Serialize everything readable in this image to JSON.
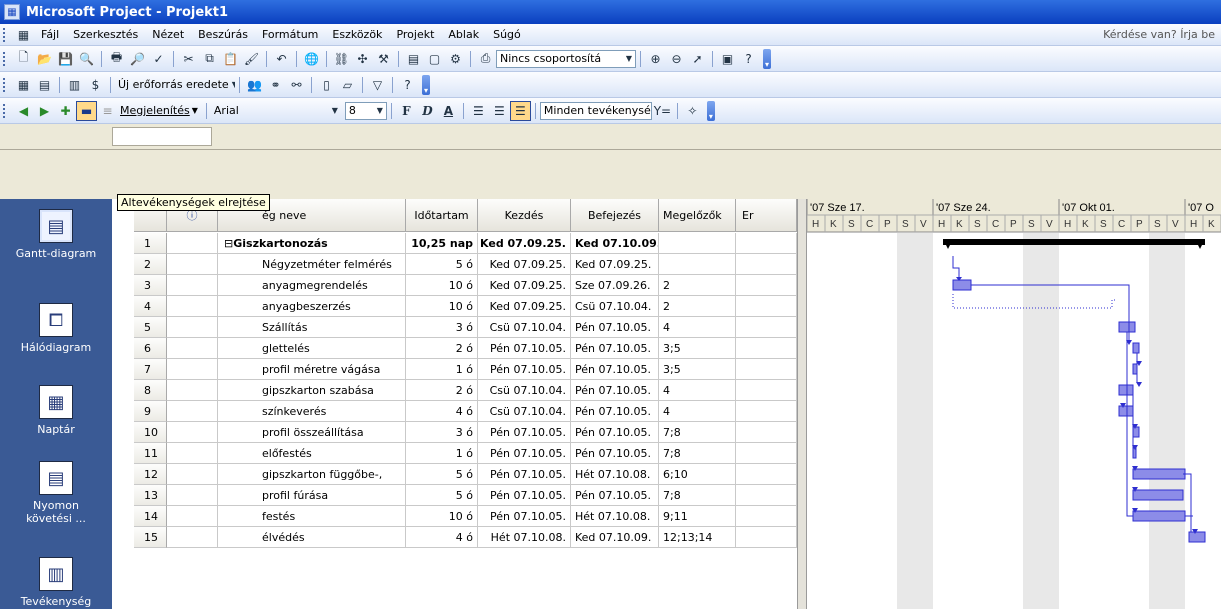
{
  "window": {
    "title": "Microsoft Project - Projekt1"
  },
  "menu": {
    "items": [
      "Fájl",
      "Szerkesztés",
      "Nézet",
      "Beszúrás",
      "Formátum",
      "Eszközök",
      "Projekt",
      "Ablak",
      "Súgó"
    ],
    "help_box": "Kérdése van? Írja be"
  },
  "toolbar1": {
    "group_combo": "Nincs csoportosítá"
  },
  "toolbar2": {
    "resource_source": "Új erőforrás eredete"
  },
  "toolbar3": {
    "display_label": "Megjelenítés",
    "font": "Arial",
    "font_size": "8",
    "bold": "F",
    "italic": "D",
    "underline": "A",
    "filter_combo": "Minden tevékenysé"
  },
  "tooltip": "Altevékenységek elrejtése",
  "viewbar": {
    "items": [
      {
        "label": "Gantt-diagram",
        "icon": "gantt-icon"
      },
      {
        "label": "Hálódiagram",
        "icon": "network-icon"
      },
      {
        "label": "Naptár",
        "icon": "calendar-icon"
      },
      {
        "label": "Nyomon követési ...",
        "icon": "tracking-gantt-icon"
      },
      {
        "label": "Tevékenység",
        "icon": "task-usage-icon"
      }
    ]
  },
  "table": {
    "headers": {
      "name": "ég neve",
      "duration": "Időtartam",
      "start": "Kezdés",
      "finish": "Befejezés",
      "predecessors": "Megelőzők",
      "resources": "Er"
    },
    "rows": [
      {
        "id": "1",
        "name": "Giszkartonozás",
        "duration": "10,25 nap",
        "start": "Ked 07.09.25.",
        "finish": "Ked 07.10.09.",
        "pred": "",
        "summary": true
      },
      {
        "id": "2",
        "name": "Négyzetméter felmérés",
        "duration": "5 ó",
        "start": "Ked 07.09.25.",
        "finish": "Ked 07.09.25.",
        "pred": ""
      },
      {
        "id": "3",
        "name": "anyagmegrendelés",
        "duration": "10 ó",
        "start": "Ked 07.09.25.",
        "finish": "Sze 07.09.26.",
        "pred": "2"
      },
      {
        "id": "4",
        "name": "anyagbeszerzés",
        "duration": "10 ó",
        "start": "Ked 07.09.25.",
        "finish": "Csü 07.10.04.",
        "pred": "2"
      },
      {
        "id": "5",
        "name": "Szállítás",
        "duration": "3 ó",
        "start": "Csü 07.10.04.",
        "finish": "Pén 07.10.05.",
        "pred": "4"
      },
      {
        "id": "6",
        "name": "glettelés",
        "duration": "2 ó",
        "start": "Pén 07.10.05.",
        "finish": "Pén 07.10.05.",
        "pred": "3;5"
      },
      {
        "id": "7",
        "name": "profil méretre vágása",
        "duration": "1 ó",
        "start": "Pén 07.10.05.",
        "finish": "Pén 07.10.05.",
        "pred": "3;5"
      },
      {
        "id": "8",
        "name": "gipszkarton szabása",
        "duration": "2 ó",
        "start": "Csü 07.10.04.",
        "finish": "Pén 07.10.05.",
        "pred": "4"
      },
      {
        "id": "9",
        "name": "színkeverés",
        "duration": "4 ó",
        "start": "Csü 07.10.04.",
        "finish": "Pén 07.10.05.",
        "pred": "4"
      },
      {
        "id": "10",
        "name": "profil összeállítása",
        "duration": "3 ó",
        "start": "Pén 07.10.05.",
        "finish": "Pén 07.10.05.",
        "pred": "7;8"
      },
      {
        "id": "11",
        "name": "előfestés",
        "duration": "1 ó",
        "start": "Pén 07.10.05.",
        "finish": "Pén 07.10.05.",
        "pred": "7;8"
      },
      {
        "id": "12",
        "name": "gipszkarton függőbe-,",
        "duration": "5 ó",
        "start": "Pén 07.10.05.",
        "finish": "Hét 07.10.08.",
        "pred": "6;10"
      },
      {
        "id": "13",
        "name": "profil fúrása",
        "duration": "5 ó",
        "start": "Pén 07.10.05.",
        "finish": "Pén 07.10.05.",
        "pred": "7;8"
      },
      {
        "id": "14",
        "name": "festés",
        "duration": "10 ó",
        "start": "Pén 07.10.05.",
        "finish": "Hét 07.10.08.",
        "pred": "9;11"
      },
      {
        "id": "15",
        "name": "élvédés",
        "duration": "4 ó",
        "start": "Hét 07.10.08.",
        "finish": "Ked 07.10.09.",
        "pred": "12;13;14"
      }
    ]
  },
  "gantt": {
    "weeks": [
      "'07 Sze 17.",
      "'07 Sze 24.",
      "'07 Okt 01.",
      "'07 O"
    ],
    "day_letters": [
      "H",
      "K",
      "S",
      "C",
      "P",
      "S",
      "V"
    ]
  },
  "colors": {
    "bar": "#3c3cd0",
    "bar_fill": "#8c8cf0",
    "title_bar": "#0a3fbf",
    "viewbar": "#3a5a95"
  }
}
